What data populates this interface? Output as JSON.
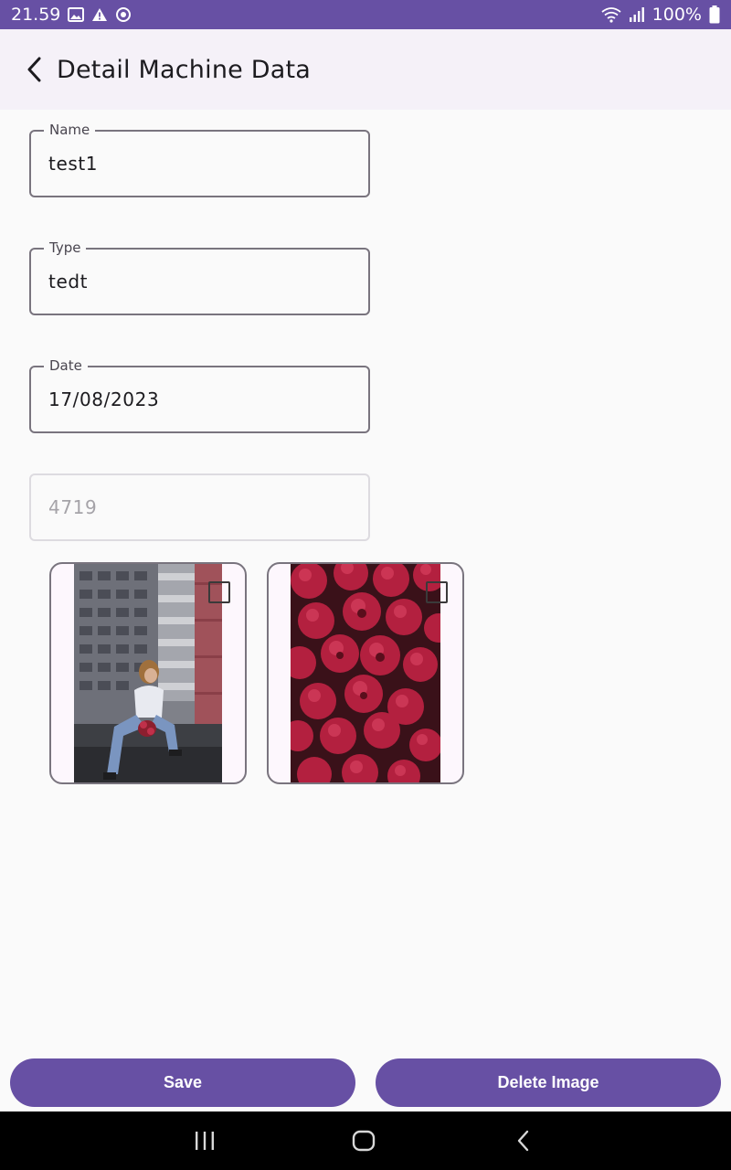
{
  "status_bar": {
    "time": "21.59",
    "battery": "100%",
    "icons": [
      "image-icon",
      "alert-icon",
      "sync-icon",
      "wifi-icon",
      "signal-icon"
    ]
  },
  "app_bar": {
    "title": "Detail Machine Data",
    "back_icon": "back-arrow-icon"
  },
  "form": {
    "name": {
      "label": "Name",
      "value": "test1"
    },
    "type": {
      "label": "Type",
      "value": "tedt"
    },
    "date": {
      "label": "Date",
      "value": "17/08/2023"
    },
    "id_field": {
      "value": "4719",
      "disabled": true
    }
  },
  "images": [
    {
      "alt": "Woman sitting in front of apartment building holding flowers",
      "checked": false
    },
    {
      "alt": "Raspberries close-up",
      "checked": false
    }
  ],
  "actions": {
    "save_label": "Save",
    "delete_label": "Delete Image"
  },
  "colors": {
    "primary": "#6750a4",
    "app_bar_bg": "#f5f1f8",
    "background": "#fafafa",
    "outline": "#79747e"
  },
  "nav_bar": {
    "icons": [
      "recent-apps-icon",
      "home-icon",
      "back-icon"
    ]
  }
}
